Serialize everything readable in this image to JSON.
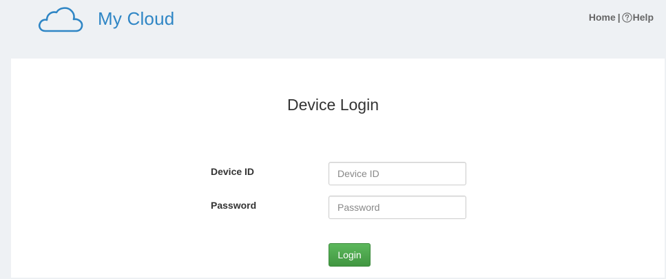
{
  "header": {
    "brand": "My Cloud",
    "logo_icon": "cloud-icon",
    "nav": {
      "home": "Home",
      "separator": "|",
      "help_icon": "question-circle-icon",
      "help": "Help"
    }
  },
  "login": {
    "title": "Device Login",
    "device_id_label": "Device ID",
    "device_id_placeholder": "Device ID",
    "device_id_value": "",
    "password_label": "Password",
    "password_placeholder": "Password",
    "password_value": "",
    "submit_label": "Login"
  },
  "colors": {
    "brand": "#2f86c5",
    "background": "#eef1f4",
    "panel": "#ffffff",
    "button": "#4cae4c"
  }
}
